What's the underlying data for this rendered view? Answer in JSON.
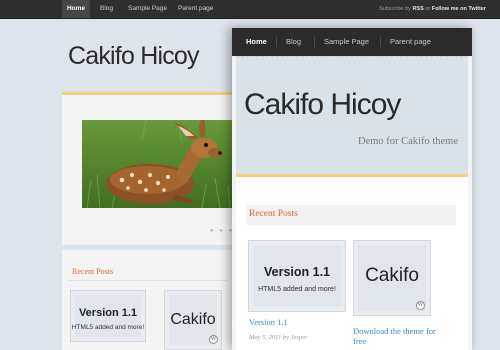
{
  "background": {
    "nav": {
      "items": [
        "Home",
        "Blog",
        "Sample Page",
        "Parent page"
      ],
      "subscribe_prefix": "Subscribe by",
      "rss": "RSS",
      "or": "or",
      "twitter": "Follow me on Twitter"
    },
    "site_title": "Cakifo Hicoy",
    "slider_dots": "● ● ●",
    "recent_posts_label": "Recent Posts",
    "posts": [
      {
        "thumb_title": "Version 1.1",
        "thumb_sub": "HTML5 added and more!"
      },
      {
        "thumb_title": "Cakifo"
      }
    ]
  },
  "foreground": {
    "nav": {
      "items": [
        "Home",
        "Blog",
        "Sample Page",
        "Parent page"
      ]
    },
    "site_title": "Cakifo Hicoy",
    "tagline": "Demo for Cakifo theme",
    "recent_posts_label": "Recent Posts",
    "posts": [
      {
        "thumb_title": "Version 1.1",
        "thumb_sub": "HTML5 added and more!",
        "title": "Version 1.1",
        "meta_date": "May 5, 2011",
        "meta_by": "by",
        "meta_author": "Jesper"
      },
      {
        "thumb_title": "Cakifo",
        "title_line1": "Download the theme for",
        "title_line2": "free"
      }
    ]
  },
  "icons": {
    "wordpress": "wordpress-logo-icon",
    "slider_dots": "slider-dots-icon"
  },
  "colors": {
    "accent": "#f0d27e",
    "link": "#3f86c4",
    "heading": "#cf6a36",
    "nav": "#2b2b2b"
  }
}
